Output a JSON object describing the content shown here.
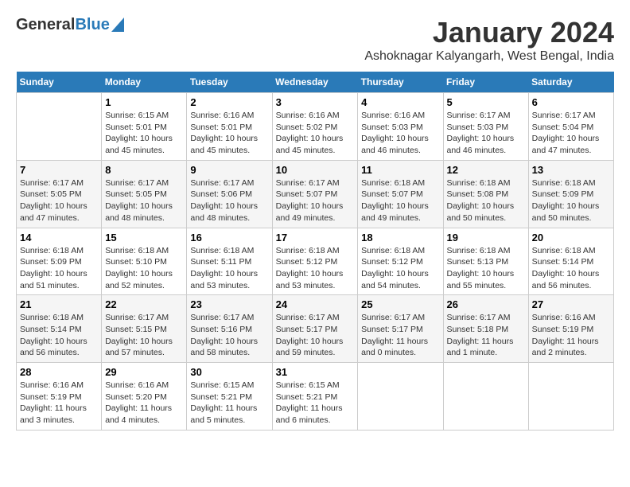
{
  "header": {
    "logo_general": "General",
    "logo_blue": "Blue",
    "month_title": "January 2024",
    "location": "Ashoknagar Kalyangarh, West Bengal, India"
  },
  "columns": [
    "Sunday",
    "Monday",
    "Tuesday",
    "Wednesday",
    "Thursday",
    "Friday",
    "Saturday"
  ],
  "weeks": [
    [
      null,
      {
        "num": "1",
        "sunrise": "6:15 AM",
        "sunset": "5:01 PM",
        "daylight": "10 hours and 45 minutes."
      },
      {
        "num": "2",
        "sunrise": "6:16 AM",
        "sunset": "5:01 PM",
        "daylight": "10 hours and 45 minutes."
      },
      {
        "num": "3",
        "sunrise": "6:16 AM",
        "sunset": "5:02 PM",
        "daylight": "10 hours and 45 minutes."
      },
      {
        "num": "4",
        "sunrise": "6:16 AM",
        "sunset": "5:03 PM",
        "daylight": "10 hours and 46 minutes."
      },
      {
        "num": "5",
        "sunrise": "6:17 AM",
        "sunset": "5:03 PM",
        "daylight": "10 hours and 46 minutes."
      },
      {
        "num": "6",
        "sunrise": "6:17 AM",
        "sunset": "5:04 PM",
        "daylight": "10 hours and 47 minutes."
      }
    ],
    [
      {
        "num": "7",
        "sunrise": "6:17 AM",
        "sunset": "5:05 PM",
        "daylight": "10 hours and 47 minutes."
      },
      {
        "num": "8",
        "sunrise": "6:17 AM",
        "sunset": "5:05 PM",
        "daylight": "10 hours and 48 minutes."
      },
      {
        "num": "9",
        "sunrise": "6:17 AM",
        "sunset": "5:06 PM",
        "daylight": "10 hours and 48 minutes."
      },
      {
        "num": "10",
        "sunrise": "6:17 AM",
        "sunset": "5:07 PM",
        "daylight": "10 hours and 49 minutes."
      },
      {
        "num": "11",
        "sunrise": "6:18 AM",
        "sunset": "5:07 PM",
        "daylight": "10 hours and 49 minutes."
      },
      {
        "num": "12",
        "sunrise": "6:18 AM",
        "sunset": "5:08 PM",
        "daylight": "10 hours and 50 minutes."
      },
      {
        "num": "13",
        "sunrise": "6:18 AM",
        "sunset": "5:09 PM",
        "daylight": "10 hours and 50 minutes."
      }
    ],
    [
      {
        "num": "14",
        "sunrise": "6:18 AM",
        "sunset": "5:09 PM",
        "daylight": "10 hours and 51 minutes."
      },
      {
        "num": "15",
        "sunrise": "6:18 AM",
        "sunset": "5:10 PM",
        "daylight": "10 hours and 52 minutes."
      },
      {
        "num": "16",
        "sunrise": "6:18 AM",
        "sunset": "5:11 PM",
        "daylight": "10 hours and 53 minutes."
      },
      {
        "num": "17",
        "sunrise": "6:18 AM",
        "sunset": "5:12 PM",
        "daylight": "10 hours and 53 minutes."
      },
      {
        "num": "18",
        "sunrise": "6:18 AM",
        "sunset": "5:12 PM",
        "daylight": "10 hours and 54 minutes."
      },
      {
        "num": "19",
        "sunrise": "6:18 AM",
        "sunset": "5:13 PM",
        "daylight": "10 hours and 55 minutes."
      },
      {
        "num": "20",
        "sunrise": "6:18 AM",
        "sunset": "5:14 PM",
        "daylight": "10 hours and 56 minutes."
      }
    ],
    [
      {
        "num": "21",
        "sunrise": "6:18 AM",
        "sunset": "5:14 PM",
        "daylight": "10 hours and 56 minutes."
      },
      {
        "num": "22",
        "sunrise": "6:17 AM",
        "sunset": "5:15 PM",
        "daylight": "10 hours and 57 minutes."
      },
      {
        "num": "23",
        "sunrise": "6:17 AM",
        "sunset": "5:16 PM",
        "daylight": "10 hours and 58 minutes."
      },
      {
        "num": "24",
        "sunrise": "6:17 AM",
        "sunset": "5:17 PM",
        "daylight": "10 hours and 59 minutes."
      },
      {
        "num": "25",
        "sunrise": "6:17 AM",
        "sunset": "5:17 PM",
        "daylight": "11 hours and 0 minutes."
      },
      {
        "num": "26",
        "sunrise": "6:17 AM",
        "sunset": "5:18 PM",
        "daylight": "11 hours and 1 minute."
      },
      {
        "num": "27",
        "sunrise": "6:16 AM",
        "sunset": "5:19 PM",
        "daylight": "11 hours and 2 minutes."
      }
    ],
    [
      {
        "num": "28",
        "sunrise": "6:16 AM",
        "sunset": "5:19 PM",
        "daylight": "11 hours and 3 minutes."
      },
      {
        "num": "29",
        "sunrise": "6:16 AM",
        "sunset": "5:20 PM",
        "daylight": "11 hours and 4 minutes."
      },
      {
        "num": "30",
        "sunrise": "6:15 AM",
        "sunset": "5:21 PM",
        "daylight": "11 hours and 5 minutes."
      },
      {
        "num": "31",
        "sunrise": "6:15 AM",
        "sunset": "5:21 PM",
        "daylight": "11 hours and 6 minutes."
      },
      null,
      null,
      null
    ]
  ]
}
